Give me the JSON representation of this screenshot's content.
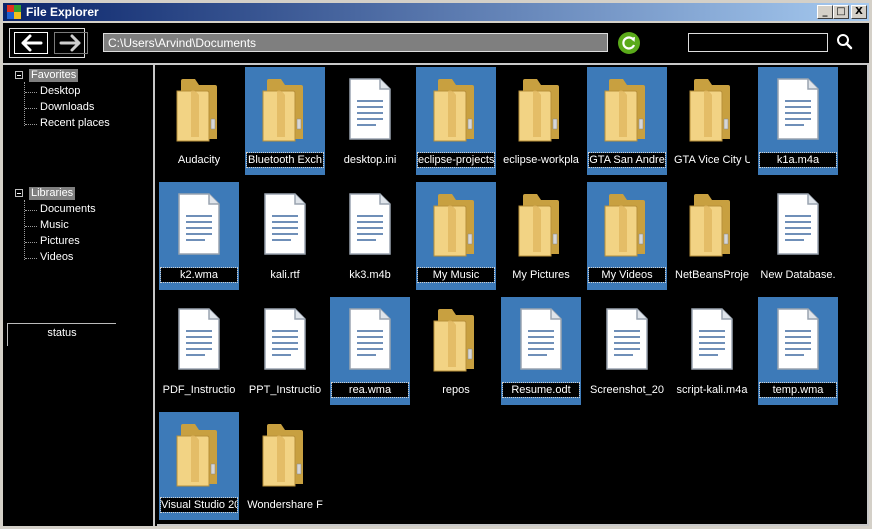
{
  "window": {
    "title": "File Explorer",
    "min_glyph": "_",
    "max_glyph": "□",
    "close_glyph": "X"
  },
  "toolbar": {
    "back_icon": "arrow-left-icon",
    "forward_icon": "arrow-right-icon",
    "address": "C:\\Users\\Arvind\\Documents",
    "refresh_icon": "refresh-icon",
    "search_value": "",
    "search_icon": "search-icon"
  },
  "colors": {
    "selection": "#3d7ab8",
    "folder": "#e8c060",
    "refresh": "#5aaa1a",
    "titlebar": "#0a246a"
  },
  "sidebar": {
    "favorites": {
      "label": "Favorites",
      "items": [
        "Desktop",
        "Downloads",
        "Recent places"
      ]
    },
    "libraries": {
      "label": "Libraries",
      "items": [
        "Documents",
        "Music",
        "Pictures",
        "Videos"
      ]
    },
    "status": "status"
  },
  "files": [
    {
      "name": "Audacity",
      "type": "folder",
      "selected": false
    },
    {
      "name": "Bluetooth Exch",
      "type": "folder",
      "selected": true
    },
    {
      "name": "desktop.ini",
      "type": "file",
      "selected": false
    },
    {
      "name": "eclipse-projects",
      "type": "folder",
      "selected": true
    },
    {
      "name": "eclipse-workpla",
      "type": "folder",
      "selected": false
    },
    {
      "name": "GTA San Andre",
      "type": "folder",
      "selected": true
    },
    {
      "name": "GTA Vice City U",
      "type": "folder",
      "selected": false
    },
    {
      "name": "k1a.m4a",
      "type": "file",
      "selected": true
    },
    {
      "name": "k2.wma",
      "type": "file",
      "selected": true
    },
    {
      "name": "kali.rtf",
      "type": "file",
      "selected": false
    },
    {
      "name": "kk3.m4b",
      "type": "file",
      "selected": false
    },
    {
      "name": "My Music",
      "type": "folder",
      "selected": true
    },
    {
      "name": "My Pictures",
      "type": "folder",
      "selected": false
    },
    {
      "name": "My Videos",
      "type": "folder",
      "selected": true
    },
    {
      "name": "NetBeansProje",
      "type": "folder",
      "selected": false
    },
    {
      "name": "New Database.",
      "type": "file",
      "selected": false
    },
    {
      "name": "PDF_Instructio",
      "type": "file",
      "selected": false
    },
    {
      "name": "PPT_Instructio",
      "type": "file",
      "selected": false
    },
    {
      "name": "rea.wma",
      "type": "file",
      "selected": true
    },
    {
      "name": "repos",
      "type": "folder",
      "selected": false
    },
    {
      "name": "Resume.odt",
      "type": "file",
      "selected": true
    },
    {
      "name": "Screenshot_20",
      "type": "file",
      "selected": false
    },
    {
      "name": "script-kali.m4a",
      "type": "file",
      "selected": false
    },
    {
      "name": "temp.wma",
      "type": "file",
      "selected": true
    },
    {
      "name": "Visual Studio 20",
      "type": "folder",
      "selected": true
    },
    {
      "name": "Wondershare F",
      "type": "folder",
      "selected": false
    }
  ]
}
